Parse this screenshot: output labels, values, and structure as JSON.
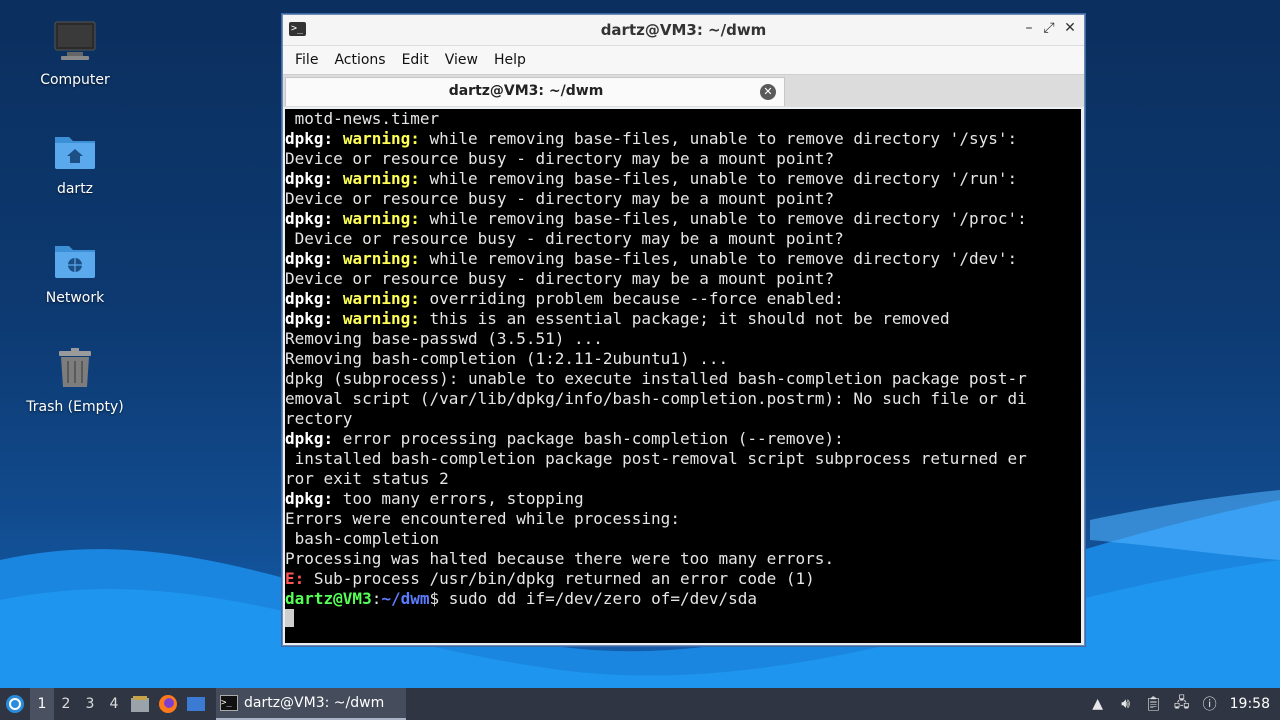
{
  "desktop": {
    "icons": [
      {
        "label": "Computer",
        "icon": "computer-icon"
      },
      {
        "label": "dartz",
        "icon": "home-folder-icon"
      },
      {
        "label": "Network",
        "icon": "network-folder-icon"
      },
      {
        "label": "Trash (Empty)",
        "icon": "trash-icon"
      }
    ]
  },
  "window": {
    "title": "dartz@VM3: ~/dwm",
    "controls": {
      "minimize": "–",
      "maximize": "⤢",
      "close": "✕"
    },
    "menu": [
      "File",
      "Actions",
      "Edit",
      "View",
      "Help"
    ],
    "tab": {
      "label": "dartz@VM3: ~/dwm",
      "close": "✕"
    }
  },
  "terminal": {
    "l1": " motd-news.timer",
    "l2_pre": "dpkg:",
    "l2_warn": "warning:",
    "l2_rest": " while removing base-files, unable to remove directory '/sys':",
    "l3": "Device or resource busy - directory may be a mount point?",
    "l4_pre": "dpkg:",
    "l4_warn": "warning:",
    "l4_rest": " while removing base-files, unable to remove directory '/run':",
    "l5": "Device or resource busy - directory may be a mount point?",
    "l6_pre": "dpkg:",
    "l6_warn": "warning:",
    "l6_rest": " while removing base-files, unable to remove directory '/proc':",
    "l7": " Device or resource busy - directory may be a mount point?",
    "l8_pre": "dpkg:",
    "l8_warn": "warning:",
    "l8_rest": " while removing base-files, unable to remove directory '/dev':",
    "l9": "Device or resource busy - directory may be a mount point?",
    "l10_pre": "dpkg:",
    "l10_warn": "warning:",
    "l10_rest": " overriding problem because --force enabled:",
    "l11_pre": "dpkg:",
    "l11_warn": "warning:",
    "l11_rest": " this is an essential package; it should not be removed",
    "l12": "Removing base-passwd (3.5.51) ...",
    "l13": "Removing bash-completion (1:2.11-2ubuntu1) ...",
    "l14": "dpkg (subprocess): unable to execute installed bash-completion package post-r",
    "l15": "emoval script (/var/lib/dpkg/info/bash-completion.postrm): No such file or di",
    "l16": "rectory",
    "l17_pre": "dpkg:",
    "l17_rest": " error processing package bash-completion (--remove):",
    "l18": " installed bash-completion package post-removal script subprocess returned er",
    "l19": "ror exit status 2",
    "l20_pre": "dpkg:",
    "l20_rest": " too many errors, stopping",
    "l21": "Errors were encountered while processing:",
    "l22": " bash-completion",
    "l23": "Processing was halted because there were too many errors.",
    "l24_pre": "E:",
    "l24_rest": " Sub-process /usr/bin/dpkg returned an error code (1)",
    "prompt_user": "dartz@VM3",
    "prompt_colon": ":",
    "prompt_path": "~/dwm",
    "prompt_cmd": "$ sudo dd if=/dev/zero of=/dev/sda"
  },
  "taskbar": {
    "workspaces": [
      "1",
      "2",
      "3",
      "4"
    ],
    "active_workspace": "1",
    "task_label": "dartz@VM3: ~/dwm",
    "clock": "19:58"
  },
  "colors": {
    "warning": "#ffff55",
    "error": "#ff5555",
    "prompt_user": "#55ff55",
    "prompt_path": "#5c7cff"
  }
}
